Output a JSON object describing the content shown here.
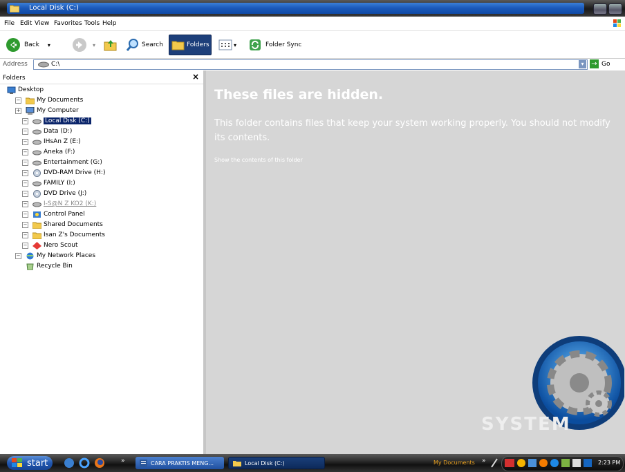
{
  "window": {
    "title": "Local Disk (C:)"
  },
  "menu": [
    "File",
    "Edit",
    "View",
    "Favorites",
    "Tools",
    "Help"
  ],
  "toolbar": {
    "back": "Back",
    "search": "Search",
    "folders": "Folders",
    "folder_sync": "Folder Sync"
  },
  "address": {
    "label": "Address",
    "value": "C:\\",
    "go": "Go"
  },
  "folders_pane": {
    "header": "Folders",
    "close": "×",
    "items": [
      {
        "label": "Desktop",
        "icon": "desktop-icon"
      },
      {
        "label": "My Documents",
        "icon": "folder-icon"
      },
      {
        "label": "My Computer",
        "icon": "computer-icon"
      },
      {
        "label": "Local Disk (C:)",
        "icon": "disk-icon",
        "selected": true
      },
      {
        "label": "Data (D:)",
        "icon": "disk-icon"
      },
      {
        "label": "IHsAn Z (E:)",
        "icon": "disk-icon"
      },
      {
        "label": "Aneka (F:)",
        "icon": "disk-icon"
      },
      {
        "label": "Entertainment (G:)",
        "icon": "disk-icon"
      },
      {
        "label": "DVD-RAM Drive (H:)",
        "icon": "dvd-icon"
      },
      {
        "label": "FAMILY (I:)",
        "icon": "disk-icon"
      },
      {
        "label": "DVD Drive (J:)",
        "icon": "dvd-icon"
      },
      {
        "label": "I-S@N Z KO2 (K:)",
        "icon": "disk-icon"
      },
      {
        "label": "Control Panel",
        "icon": "control-panel-icon"
      },
      {
        "label": "Shared Documents",
        "icon": "folder-icon"
      },
      {
        "label": "Isan Z's Documents",
        "icon": "folder-icon"
      },
      {
        "label": "Nero Scout",
        "icon": "nero-icon"
      },
      {
        "label": "My Network Places",
        "icon": "network-icon"
      },
      {
        "label": "Recycle Bin",
        "icon": "recycle-bin-icon"
      }
    ]
  },
  "content": {
    "title": "These files are hidden.",
    "message": "This folder contains files that keep your system working properly. You should not modify its contents.",
    "link": "Show the contents of this folder",
    "logo_text": "SYSTEM"
  },
  "taskbar": {
    "start": "start",
    "tasks": [
      "CARA PRAKTIS MENG...",
      "Local Disk (C:)"
    ],
    "tray_label": "My Documents",
    "clock": "2:23 PM"
  }
}
